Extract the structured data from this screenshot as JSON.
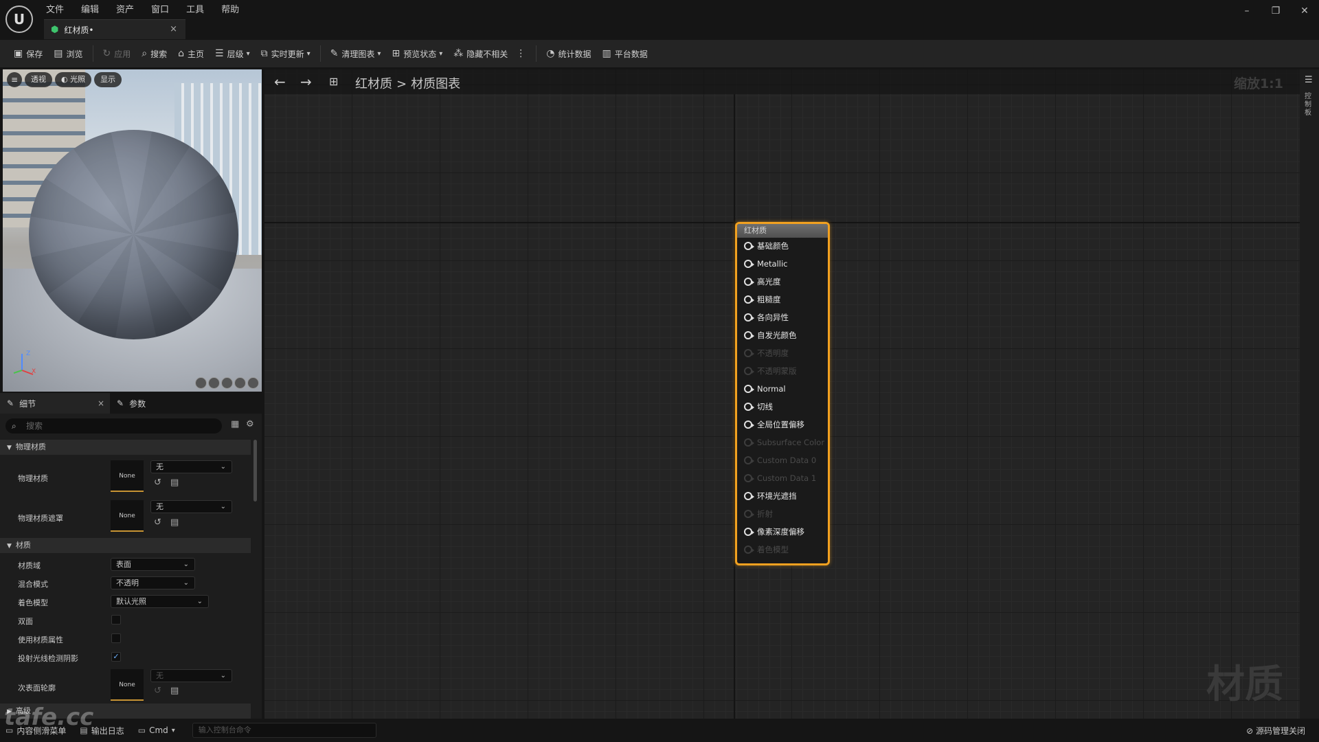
{
  "app": {
    "logo_text": "U"
  },
  "menu": [
    "文件",
    "编辑",
    "资产",
    "窗口",
    "工具",
    "帮助"
  ],
  "doc_tab": {
    "label": "红材质•",
    "close": "×"
  },
  "window_controls": {
    "minimize": "–",
    "restore": "❐",
    "close": "✕"
  },
  "toolbar": {
    "save": "保存",
    "browse": "浏览",
    "apply": "应用",
    "search": "搜索",
    "home": "主页",
    "hierarchy": "层级",
    "live_update": "实时更新",
    "clean_graph": "清理图表",
    "preview_state": "预览状态",
    "hide_unrelated": "隐藏不相关",
    "stats": "统计数据",
    "platform_stats": "平台数据"
  },
  "viewport": {
    "perspective": "透视",
    "lit": "光照",
    "show": "显示",
    "axis_z": "Z",
    "axis_x": "X"
  },
  "details": {
    "tab_details": "细节",
    "tab_params": "参数",
    "tab_close": "×",
    "search_placeholder": "搜索",
    "cat_physical": "物理材质",
    "phys_material_label": "物理材质",
    "phys_material_thumb": "None",
    "phys_material_value": "无",
    "phys_mask_label": "物理材质遮罩",
    "phys_mask_thumb": "None",
    "phys_mask_value": "无",
    "cat_material": "材质",
    "domain_label": "材质域",
    "domain_value": "表面",
    "blend_label": "混合模式",
    "blend_value": "不透明",
    "shading_label": "着色模型",
    "shading_value": "默认光照",
    "two_sided_label": "双面",
    "two_sided": false,
    "use_attr_label": "使用材质属性",
    "use_attr": false,
    "raytrace_shadow_label": "投射光线检测阴影",
    "raytrace_shadow": true,
    "subsurface_label": "次表面轮廓",
    "subsurface_thumb": "None",
    "subsurface_value": "无",
    "cat_advanced": "高级"
  },
  "graph": {
    "breadcrumb_root": "红材质",
    "breadcrumb_sep": ">",
    "breadcrumb_leaf": "材质图表",
    "zoom": "缩放1:1",
    "watermark": "材质"
  },
  "node": {
    "title": "红材质",
    "pins": [
      {
        "label": "基础颜色",
        "enabled": true
      },
      {
        "label": "Metallic",
        "enabled": true
      },
      {
        "label": "高光度",
        "enabled": true
      },
      {
        "label": "粗糙度",
        "enabled": true
      },
      {
        "label": "各向异性",
        "enabled": true
      },
      {
        "label": "自发光颜色",
        "enabled": true
      },
      {
        "label": "不透明度",
        "enabled": false
      },
      {
        "label": "不透明蒙版",
        "enabled": false
      },
      {
        "label": "Normal",
        "enabled": true
      },
      {
        "label": "切线",
        "enabled": true
      },
      {
        "label": "全局位置偏移",
        "enabled": true
      },
      {
        "label": "Subsurface Color",
        "enabled": false
      },
      {
        "label": "Custom Data 0",
        "enabled": false
      },
      {
        "label": "Custom Data 1",
        "enabled": false
      },
      {
        "label": "环境光遮挡",
        "enabled": true
      },
      {
        "label": "折射",
        "enabled": false
      },
      {
        "label": "像素深度偏移",
        "enabled": true
      },
      {
        "label": "着色模型",
        "enabled": false
      }
    ]
  },
  "right_panel": {
    "label": "控制板"
  },
  "statusbar": {
    "content_drawer": "内容侧滑菜单",
    "output_log": "输出日志",
    "cmd": "Cmd",
    "console_placeholder": "输入控制台命令",
    "source_control": "源码管理关闭"
  },
  "overlay": {
    "site_logo": "tafe.cc"
  }
}
